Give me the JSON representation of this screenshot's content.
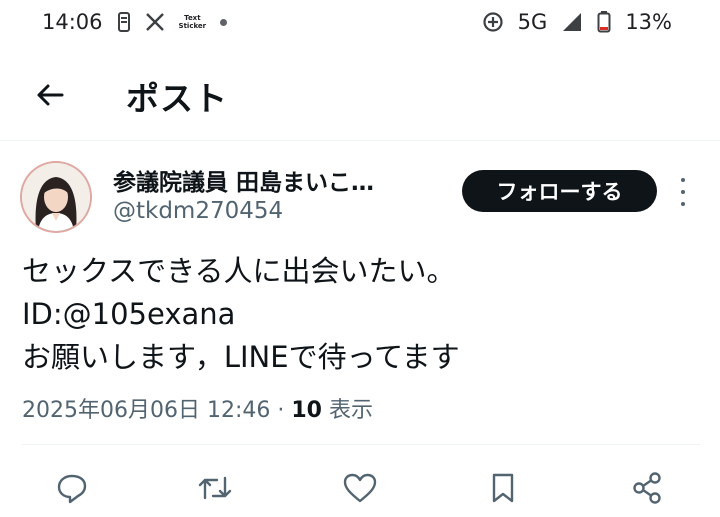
{
  "status_bar": {
    "time": "14:06",
    "text_sticker_line1": "Text",
    "text_sticker_line2": "Sticker",
    "network": "5G",
    "battery": "13%"
  },
  "header": {
    "title": "ポスト"
  },
  "post": {
    "author_name": "参議院議員 田島まいこ…",
    "handle": "@tkdm270454",
    "follow_label": "フォローする",
    "lines": [
      "セックスできる人に出会いたい。",
      "ID:@105exana",
      "お願いします，LINEで待ってます"
    ],
    "timestamp": "2025年06月06日 12:46 · ",
    "views_count": "10",
    "views_label": " 表示"
  },
  "colors": {
    "text": "#0f1419",
    "secondary": "#536471",
    "follow_bg": "#0f1419"
  },
  "icons": [
    "reply-icon",
    "retweet-icon",
    "like-icon",
    "bookmark-icon",
    "share-icon"
  ]
}
